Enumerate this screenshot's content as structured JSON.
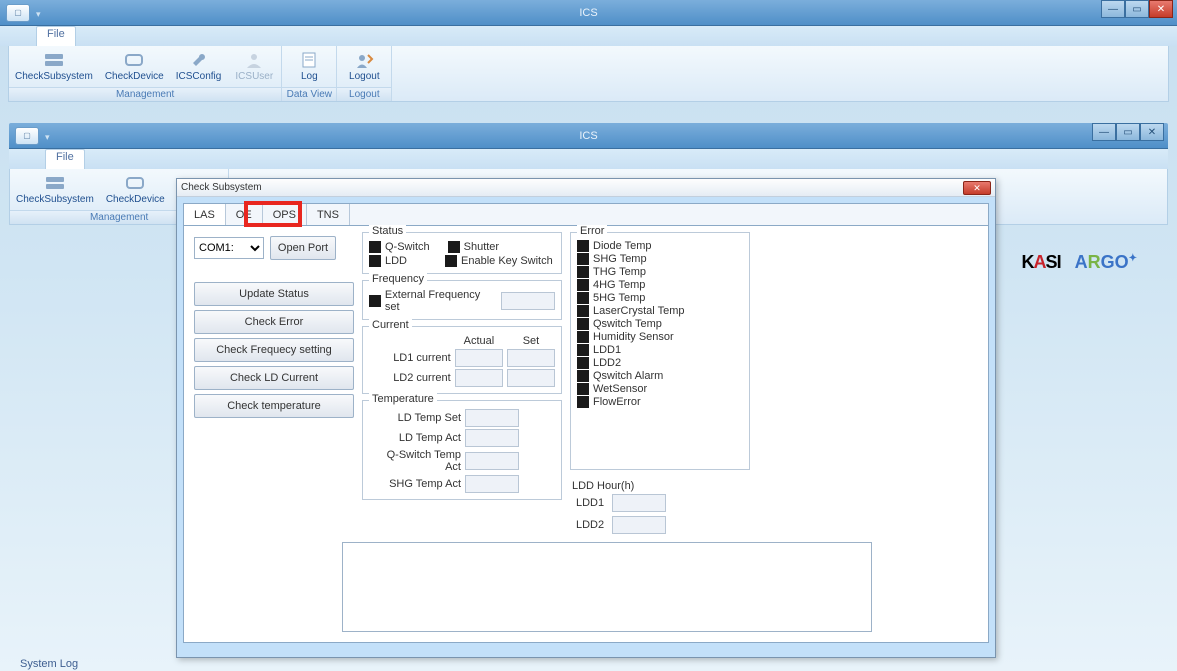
{
  "app": {
    "title": "ICS"
  },
  "ribbon": {
    "file_tab": "File",
    "groups": {
      "management": "Management",
      "dataview": "Data View",
      "logout": "Logout"
    },
    "buttons": {
      "check_subsystem": "CheckSubsystem",
      "check_device": "CheckDevice",
      "ics_config": "ICSConfig",
      "ics_user": "ICSUser",
      "log": "Log",
      "logout": "Logout"
    }
  },
  "dialog": {
    "title": "Check Subsystem",
    "tabs": {
      "las": "LAS",
      "oe": "OE",
      "ops": "OPS",
      "tns": "TNS"
    },
    "port": {
      "options": [
        "COM1:"
      ],
      "open": "Open Port"
    },
    "actions": {
      "update_status": "Update Status",
      "check_error": "Check Error",
      "check_freq": "Check Frequecy setting",
      "check_ld": "Check LD Current",
      "check_temp": "Check temperature"
    },
    "status": {
      "title": "Status",
      "qswitch": "Q-Switch",
      "shutter": "Shutter",
      "ldd": "LDD",
      "enable_key": "Enable Key Switch"
    },
    "frequency": {
      "title": "Frequency",
      "ext_set": "External Frequency set"
    },
    "current": {
      "title": "Current",
      "actual": "Actual",
      "set": "Set",
      "ld1": "LD1 current",
      "ld2": "LD2 current"
    },
    "temperature": {
      "title": "Temperature",
      "ld_set": "LD Temp Set",
      "ld_act": "LD Temp Act",
      "qs_act": "Q-Switch Temp Act",
      "shg_act": "SHG Temp Act"
    },
    "error": {
      "title": "Error",
      "items": [
        "Diode Temp",
        "SHG Temp",
        "THG Temp",
        "4HG Temp",
        "5HG Temp",
        "LaserCrystal Temp",
        "Qswitch Temp",
        "Humidity Sensor",
        "LDD1",
        "LDD2",
        "Qswitch Alarm",
        "WetSensor",
        "FlowError"
      ]
    },
    "ldd_hour": {
      "title": "LDD Hour(h)",
      "ldd1": "LDD1",
      "ldd2": "LDD2"
    }
  },
  "footer": {
    "system_log": "System Log"
  },
  "logos": {
    "kasi": "KASI",
    "argo": "ARGO"
  }
}
